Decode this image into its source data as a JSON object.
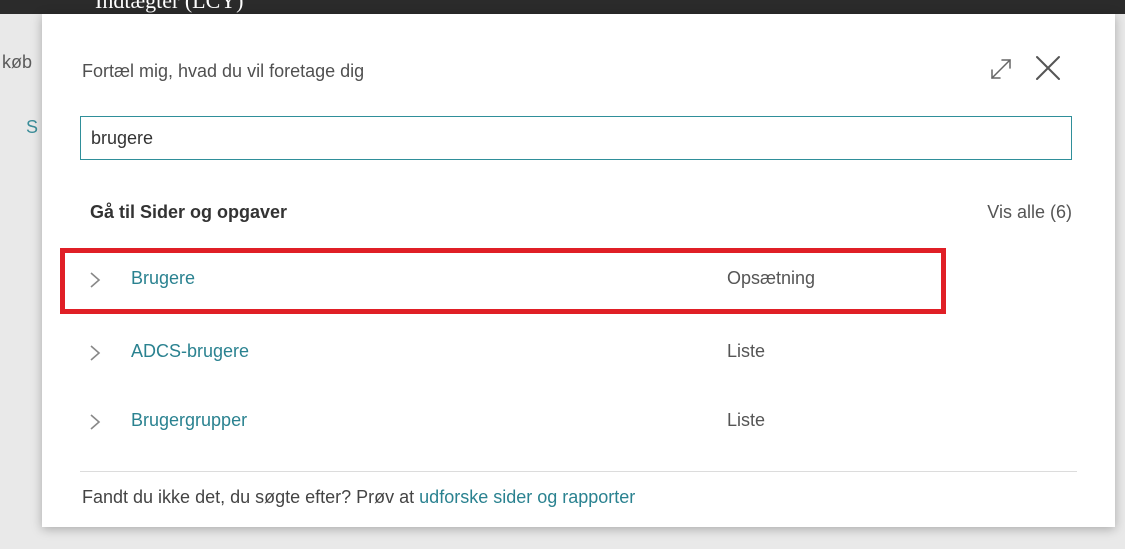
{
  "top_strip_text": "Indtægter (LCY)",
  "background": {
    "text1": "køb",
    "text2": "S"
  },
  "dialog": {
    "title": "Fortæl mig, hvad du vil foretage dig",
    "search_value": "brugere",
    "section_heading": "Gå til Sider og opgaver",
    "show_all": "Vis alle (6)",
    "results": [
      {
        "label": "Brugere",
        "type": "Opsætning",
        "highlighted": true
      },
      {
        "label": "ADCS-brugere",
        "type": "Liste",
        "highlighted": false
      },
      {
        "label": "Brugergrupper",
        "type": "Liste",
        "highlighted": false
      }
    ],
    "footer": {
      "text": "Fandt du ikke det, du søgte efter? Prøv at ",
      "link": "udforske sider og rapporter"
    }
  },
  "colors": {
    "accent": "#2a8290",
    "input_border": "#2f8f9a",
    "highlight": "#e01f26",
    "top_strip": "#2b2b2b",
    "backdrop": "#e9e9e9"
  },
  "icons": {
    "expand": "expand-icon",
    "close": "close-icon",
    "chevron": "chevron-right-icon"
  }
}
